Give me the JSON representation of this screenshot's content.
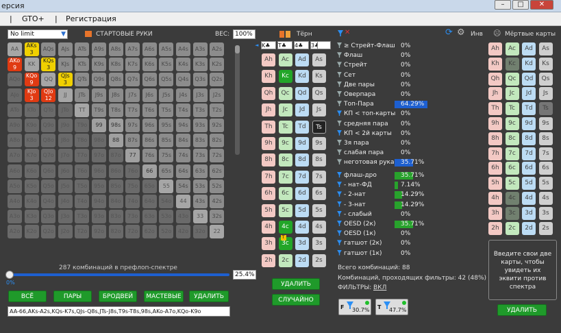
{
  "window": {
    "title": "ерсия",
    "min": "–",
    "max": "□",
    "close": "✕"
  },
  "menu": {
    "sep1": "|",
    "gto": "GTO+",
    "sep2": "|",
    "reg": "Регистрация"
  },
  "left": {
    "mode": "No limit",
    "header": "СТАРТОВЫЕ РУКИ",
    "weight_label": "ВЕС:",
    "weight": "100%",
    "combos_text": "287 комбинаций в префлоп-спектре",
    "pct_start": "0%",
    "pct": "25.4%",
    "range_text": "AA-66,AKs-A2s,KQs-K7s,QJs-Q8s,JTs-J8s,T9s-T8s,98s,AKo-A7o,KQo-K9o",
    "buttons": {
      "all": "ВСЁ",
      "pairs": "ПАРЫ",
      "broadway": "БРОДВЕЙ",
      "suited": "МАСТЕВЫЕ",
      "delete": "УДАЛИТЬ"
    },
    "grid": [
      [
        "AA",
        "AKs|3",
        "AQs",
        "AJs",
        "ATs",
        "A9s",
        "A8s",
        "A7s",
        "A6s",
        "A5s",
        "A4s",
        "A3s",
        "A2s"
      ],
      [
        "AKo|9",
        "KK",
        "KQs|3",
        "KJs",
        "KTs",
        "K9s",
        "K8s",
        "K7s",
        "K6s",
        "K5s",
        "K4s",
        "K3s",
        "K2s"
      ],
      [
        "AQo",
        "KQo|9",
        "QQ",
        "QJs|3",
        "QTs",
        "Q9s",
        "Q8s",
        "Q7s",
        "Q6s",
        "Q5s",
        "Q4s",
        "Q3s",
        "Q2s"
      ],
      [
        "AJo",
        "KJo|3",
        "QJo|12",
        "JJ",
        "JTs",
        "J9s",
        "J8s",
        "J7s",
        "J6s",
        "J5s",
        "J4s",
        "J3s",
        "J2s"
      ],
      [
        "ATo",
        "KTo",
        "QTo",
        "JTo",
        "TT",
        "T9s",
        "T8s",
        "T7s",
        "T6s",
        "T5s",
        "T4s",
        "T3s",
        "T2s"
      ],
      [
        "A9o",
        "K9o",
        "Q9o",
        "J9o",
        "T9o",
        "99",
        "98s",
        "97s",
        "96s",
        "95s",
        "94s",
        "93s",
        "92s"
      ],
      [
        "A8o",
        "K8o",
        "Q8o",
        "J8o",
        "T8o",
        "98o",
        "88",
        "87s",
        "86s",
        "85s",
        "84s",
        "83s",
        "82s"
      ],
      [
        "A7o",
        "K7o",
        "Q7o",
        "J7o",
        "T7o",
        "97o",
        "87o",
        "77",
        "76s",
        "75s",
        "74s",
        "73s",
        "72s"
      ],
      [
        "A6o",
        "K6o",
        "Q6o",
        "J6o",
        "T6o",
        "96o",
        "86o",
        "76o",
        "66",
        "65s",
        "64s",
        "63s",
        "62s"
      ],
      [
        "A5o",
        "K5o",
        "Q5o",
        "J5o",
        "T5o",
        "95o",
        "85o",
        "75o",
        "65o",
        "55",
        "54s",
        "53s",
        "52s"
      ],
      [
        "A4o",
        "K4o",
        "Q4o",
        "J4o",
        "T4o",
        "94o",
        "84o",
        "74o",
        "64o",
        "54o",
        "44",
        "43s",
        "42s"
      ],
      [
        "A3o",
        "K3o",
        "Q3o",
        "J3o",
        "T3o",
        "93o",
        "83o",
        "73o",
        "63o",
        "53o",
        "43o",
        "33",
        "32s"
      ],
      [
        "A2o",
        "K2o",
        "Q2o",
        "J2o",
        "T2o",
        "92o",
        "82o",
        "72o",
        "62o",
        "52o",
        "42o",
        "32o",
        "22"
      ]
    ]
  },
  "board": {
    "title": "Тёрн",
    "cards": [
      "K♣",
      "T♣",
      "4♣",
      "3♣"
    ],
    "delete": "УДАЛИТЬ",
    "random": "СЛУЧАЙНО",
    "ranks": [
      "A",
      "K",
      "Q",
      "J",
      "T",
      "9",
      "8",
      "7",
      "6",
      "5",
      "4",
      "3",
      "2"
    ],
    "badge": "T"
  },
  "filters": {
    "inv": "Инв",
    "rows": [
      {
        "n": "≥ Стрейт-Флаш",
        "v": "0%"
      },
      {
        "n": "Флаш",
        "v": "0%"
      },
      {
        "n": "Стрейт",
        "v": "0%"
      },
      {
        "n": "Сет",
        "v": "0%"
      },
      {
        "n": "Две пары",
        "v": "0%"
      },
      {
        "n": "Оверпара",
        "v": "0%"
      },
      {
        "n": "Топ-Пара",
        "v": "64.29%"
      },
      {
        "n": "КП < топ-карты",
        "v": "0%"
      },
      {
        "n": "средняя пара",
        "v": "0%"
      },
      {
        "n": "КП < 2й карты",
        "v": "0%"
      },
      {
        "n": "3я пара",
        "v": "0%"
      },
      {
        "n": "слабая пара",
        "v": "0%"
      },
      {
        "n": "неготовая рука",
        "v": "35.71%"
      }
    ],
    "rows2": [
      {
        "n": "флаш-дро",
        "v": "35.71%"
      },
      {
        "n": "- нат-ФД",
        "v": "7.14%"
      },
      {
        "n": "- 2-нат",
        "v": "14.29%"
      },
      {
        "n": "- 3-нат",
        "v": "14.29%"
      },
      {
        "n": "- слабый",
        "v": "0%"
      },
      {
        "n": "OESD (2к)",
        "v": "35.71%"
      },
      {
        "n": "OESD (1к)",
        "v": "0%"
      },
      {
        "n": "гатшот (2к)",
        "v": "0%"
      },
      {
        "n": "гатшот (1к)",
        "v": "0%"
      }
    ],
    "total": "Всего комбинаций: 88",
    "passing": "Комбинаций, проходящих фильтры: 42 (48%)",
    "filters_label": "ФИЛЬТРЫ:",
    "filters_val": "ВКЛ",
    "b1_letter": "F",
    "b1": "30.7%",
    "b2_letter": "T",
    "b2": "47.7%"
  },
  "dead": {
    "title": "Мёртвые карты",
    "info": "Введите свои две карты, чтобы увидеть их эквити против спектра",
    "delete": "УДАЛИТЬ"
  },
  "colors": {
    "green": "#1f9a2a",
    "blue": "#1d5fd0",
    "yellow": "#f0d000",
    "red": "#e03a12"
  }
}
